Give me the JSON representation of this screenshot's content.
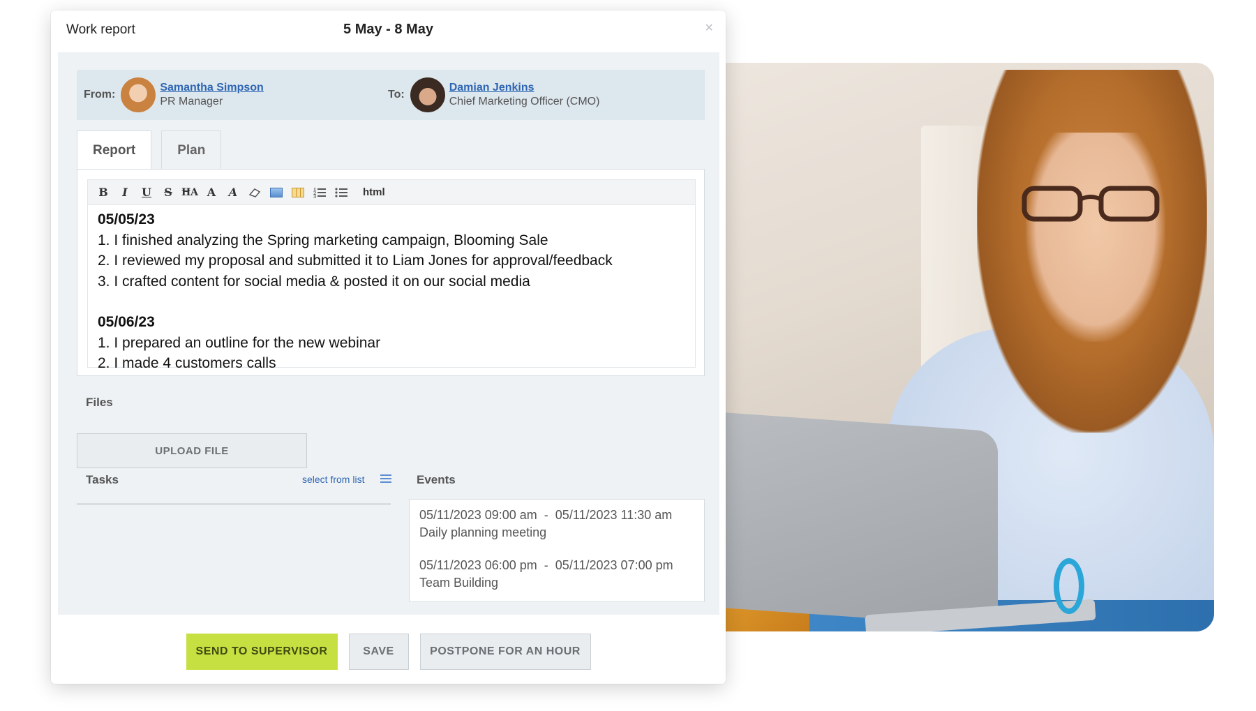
{
  "dialog": {
    "title": "Work report",
    "date_range": "5 May - 8 May",
    "close_icon": "×"
  },
  "from": {
    "label": "From:",
    "name": "Samantha Simpson",
    "role": "PR Manager"
  },
  "to": {
    "label": "To:",
    "name": "Damian Jenkins",
    "role": "Chief Marketing Officer (CMO)"
  },
  "tabs": [
    {
      "label": "Report",
      "active": true
    },
    {
      "label": "Plan",
      "active": false
    }
  ],
  "toolbar": {
    "bold": "B",
    "italic": "I",
    "underline": "U",
    "strike": "S",
    "font_size": "ĦA",
    "text_color": "A",
    "bg_color": "A",
    "html": "html",
    "icons": [
      "bold-icon",
      "italic-icon",
      "underline-icon",
      "strikethrough-icon",
      "font-size-icon",
      "text-color-icon",
      "highlight-color-icon",
      "eraser-icon",
      "image-icon",
      "table-icon",
      "ordered-list-icon",
      "unordered-list-icon"
    ]
  },
  "report": {
    "day1": {
      "date": "05/05/23",
      "items": [
        "1. I finished analyzing the Spring marketing campaign, Blooming Sale",
        "2. I reviewed my proposal and submitted it to Liam Jones for approval/feedback",
        "3. I crafted content for social media & posted it on our social media"
      ]
    },
    "day2": {
      "date": "05/06/23",
      "items": [
        "1. I prepared an outline for the new webinar",
        "2. I made 4 customers calls"
      ]
    }
  },
  "files": {
    "label": "Files",
    "upload_label": "UPLOAD FILE"
  },
  "tasks": {
    "label": "Tasks",
    "select_link": "select from list"
  },
  "events": {
    "label": "Events",
    "items": [
      {
        "time": "05/11/2023 09:00 am  -  05/11/2023 11:30 am",
        "title": "Daily planning meeting"
      },
      {
        "time": "05/11/2023 06:00 pm  -  05/11/2023 07:00 pm",
        "title": "Team Building"
      }
    ]
  },
  "actions": {
    "send": "SEND TO SUPERVISOR",
    "save": "SAVE",
    "postpone": "POSTPONE FOR AN HOUR"
  },
  "colors": {
    "accent_green": "#c6e042",
    "link_blue": "#2f66b3",
    "panel_bg": "#eef2f4",
    "header_strip": "#dde7ee"
  }
}
